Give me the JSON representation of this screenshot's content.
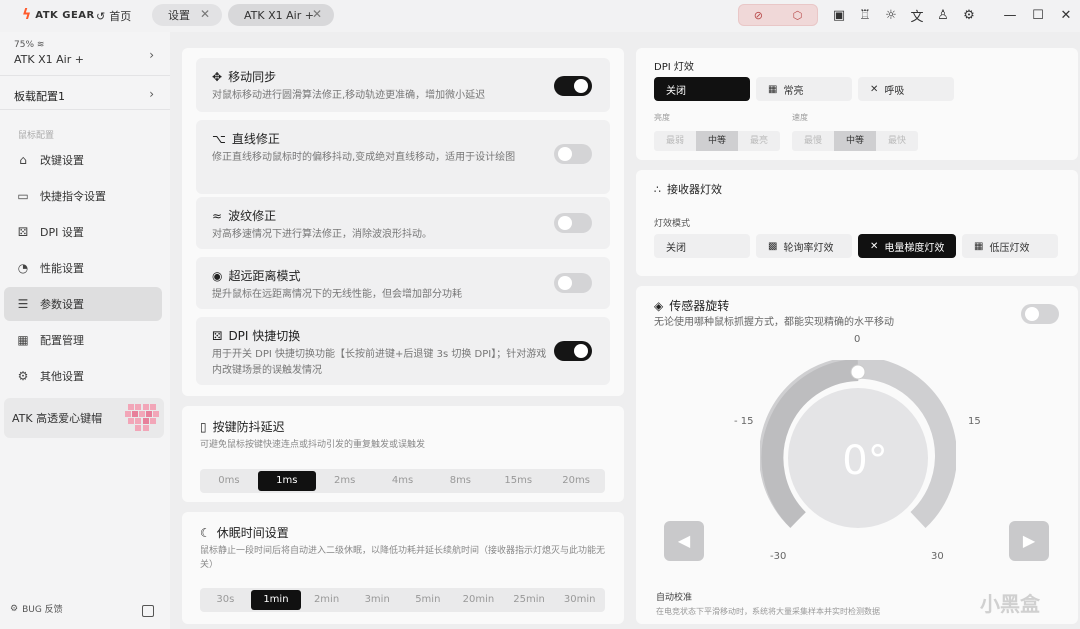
{
  "topbar": {
    "brand": "ATK GEAR",
    "home_label": "首页",
    "tabs": [
      {
        "label": "设置"
      },
      {
        "label": "ATK X1 Air +"
      }
    ]
  },
  "sidebar": {
    "battery": "75%",
    "device_name": "ATK X1 Air +",
    "profile": "板载配置1",
    "section_label": "鼠标配置",
    "items": [
      {
        "label": "改键设置",
        "icon": "mouse-icon"
      },
      {
        "label": "快捷指令设置",
        "icon": "terminal-icon"
      },
      {
        "label": "DPI 设置",
        "icon": "dice-icon"
      },
      {
        "label": "性能设置",
        "icon": "gauge-icon"
      },
      {
        "label": "参数设置",
        "icon": "sliders-icon"
      },
      {
        "label": "配置管理",
        "icon": "grid-icon"
      },
      {
        "label": "其他设置",
        "icon": "gear-icon"
      }
    ],
    "keyboard_card": "ATK 高透爱心键帽",
    "bug_feedback": "BUG 反馈"
  },
  "params": {
    "rows": [
      {
        "title": "移动同步",
        "desc": "对鼠标移动进行圆滑算法修正,移动轨迹更准确，增加微小延迟",
        "on": true
      },
      {
        "title": "直线修正",
        "desc": "修正直线移动鼠标时的偏移抖动,变成绝对直线移动，适用于设计绘图",
        "on": false
      },
      {
        "title": "波纹修正",
        "desc": "对高移速情况下进行算法修正，消除波浪形抖动。",
        "on": false
      },
      {
        "title": "超远距离模式",
        "desc": "提升鼠标在远距离情况下的无线性能，但会增加部分功耗",
        "on": false
      },
      {
        "title": "DPI 快捷切换",
        "desc": "用于开关 DPI 快捷切换功能【长按前进键+后退键 3s 切换 DPI】；针对游戏内改键场景的误触发情况",
        "on": true
      }
    ]
  },
  "debounce": {
    "title": "按键防抖延迟",
    "desc": "可避免鼠标按键快速连点或抖动引发的重复触发或误触发",
    "options": [
      "0ms",
      "1ms",
      "2ms",
      "4ms",
      "8ms",
      "15ms",
      "20ms"
    ],
    "selected": "1ms"
  },
  "sleep": {
    "title": "休眠时间设置",
    "desc": "鼠标静止一段时间后将自动进入二级休眠，以降低功耗并延长续航时间（接收器指示灯熄灭与此功能无关）",
    "options": [
      "30s",
      "1min",
      "2min",
      "3min",
      "5min",
      "20min",
      "25min",
      "30min"
    ],
    "selected": "1min"
  },
  "dpi_light": {
    "title": "DPI 灯效",
    "modes": [
      "关闭",
      "常亮",
      "呼吸"
    ],
    "selected": "关闭",
    "brightness_label": "亮度",
    "brightness": [
      "最弱",
      "中等",
      "最亮"
    ],
    "speed_label": "速度",
    "speed": [
      "最慢",
      "中等",
      "最快"
    ]
  },
  "receiver_light": {
    "title": "接收器灯效",
    "mode_label": "灯效模式",
    "modes": [
      "关闭",
      "轮询率灯效",
      "电量梯度灯效",
      "低压灯效"
    ],
    "selected": "电量梯度灯效"
  },
  "sensor": {
    "title": "传感器旋转",
    "desc": "无论使用哪种鼠标抓握方式，都能实现精确的水平移动",
    "enabled": false,
    "angle_display": "0°",
    "ticks": {
      "top": "0",
      "left15": "- 15",
      "right15": "15",
      "left30": "-30",
      "right30": "30"
    },
    "auto_label": "自动校准",
    "auto_desc": "在电竞状态下平滑移动时，系统将大量采集样本并实时检测数据"
  },
  "watermark": "小黑盒"
}
